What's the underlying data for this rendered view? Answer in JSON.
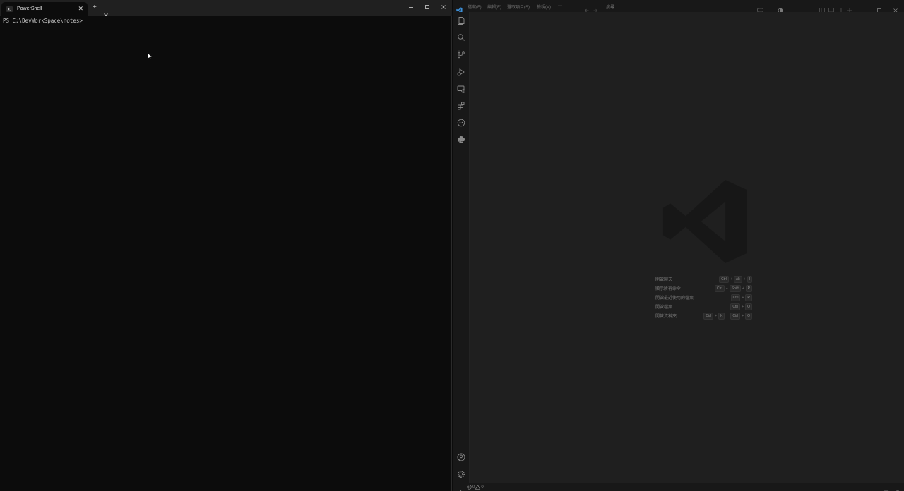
{
  "terminal": {
    "tab_title": "PowerShell",
    "tab_close": "✕",
    "new_tab": "+",
    "prompt": "PS C:\\DevWorkSpace\\notes>"
  },
  "vscode": {
    "menu": {
      "file": "檔案(F)",
      "edit": "編輯(E)",
      "selection": "選取項目(S)",
      "view": "檢視(V)",
      "more": "···",
      "search": "搜尋"
    },
    "shortcuts": [
      {
        "label": "開啟聊天",
        "keys": [
          "Ctrl",
          "Alt",
          "I"
        ]
      },
      {
        "label": "顯示所有命令",
        "keys": [
          "Ctrl",
          "Shift",
          "P"
        ]
      },
      {
        "label": "開啟最近使用的檔案",
        "keys": [
          "Ctrl",
          "R"
        ]
      },
      {
        "label": "開啟檔案",
        "keys": [
          "Ctrl",
          "O"
        ]
      },
      {
        "label": "開啟資料夾",
        "chords": [
          [
            "Ctrl",
            "K"
          ],
          [
            "Ctrl",
            "O"
          ]
        ]
      }
    ],
    "status": {
      "errors": "0",
      "warnings": "0"
    }
  },
  "colors": {
    "terminal_bg": "#0c0c0c",
    "vscode_bg": "#1f1f1f",
    "vscode_accent": "#3c8fd8"
  }
}
